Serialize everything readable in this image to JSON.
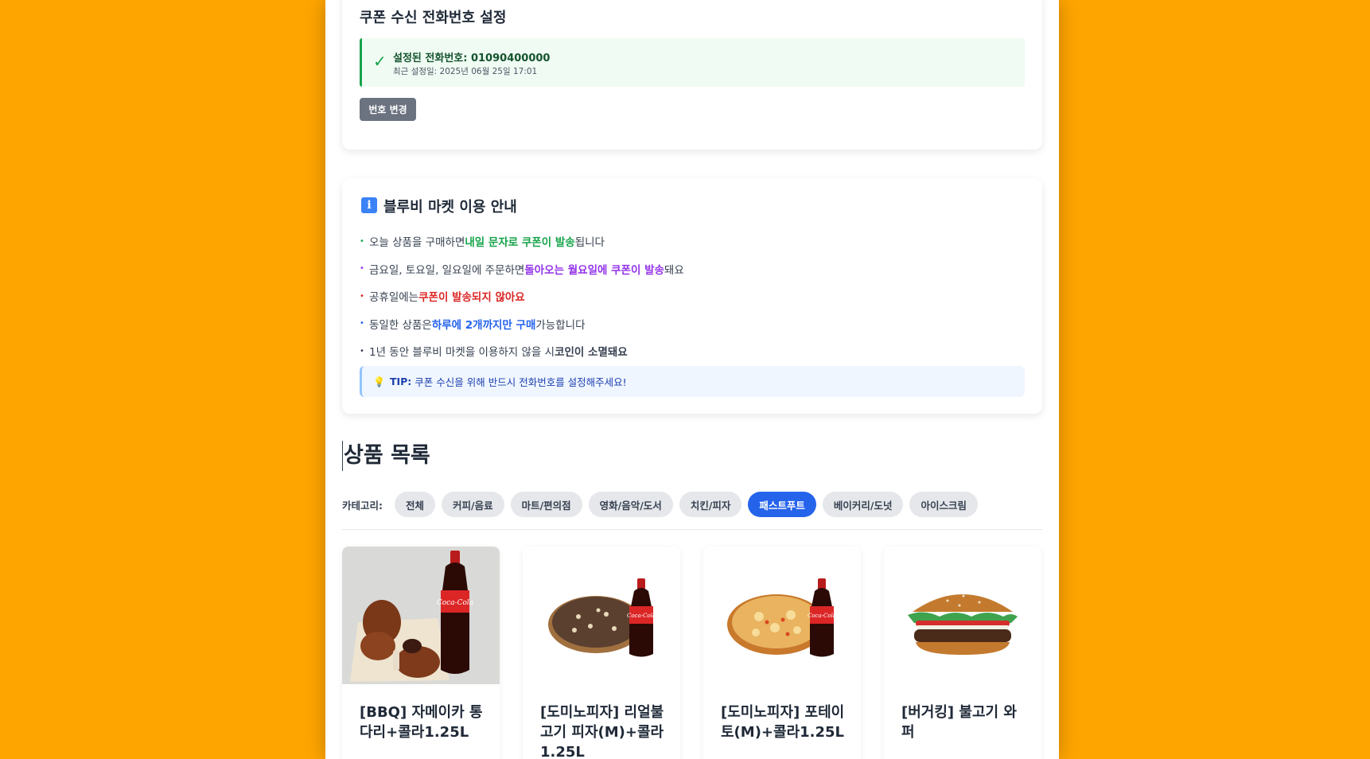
{
  "colors": {
    "background": "#FFA500",
    "accent": "#2563eb",
    "success": "#16a34a",
    "purple": "#9333ea",
    "danger": "#dc2626"
  },
  "phone_settings": {
    "title": "쿠폰 수신 전화번호 설정",
    "check_icon": "✓",
    "phone_line": "설정된 전화번호: 01090400000",
    "updated": "최근 설정일: 2025년 06월 25일 17:01",
    "change_button": "번호 변경"
  },
  "guide": {
    "icon": "info-icon",
    "title": "블루비 마켓 이용 안내",
    "items": [
      {
        "pre": "오늘 상품을 구매하면 ",
        "hl": "내일 문자로 쿠폰이 발송",
        "post": "됩니다",
        "color": "#16a34a"
      },
      {
        "pre": "금요일, 토요일, 일요일에 주문하면 ",
        "hl": "돌아오는 월요일에 쿠폰이 발송",
        "post": "돼요",
        "color": "#9333ea"
      },
      {
        "pre": "공휴일에는 ",
        "hl": "쿠폰이 발송되지 않아요",
        "post": "",
        "color": "#dc2626"
      },
      {
        "pre": "동일한 상품은 ",
        "hl": "하루에 2개까지만 구매",
        "post": " 가능합니다",
        "color": "#2563eb"
      },
      {
        "pre": "1년 동안 블루비 마켓을 이용하지 않을 시 ",
        "hl": "코인이 소멸돼요",
        "post": "",
        "color": "#374151"
      }
    ],
    "tip_label": "TIP:",
    "tip_text": "쿠폰 수신을 위해 반드시 전화번호를 설정해주세요!"
  },
  "products_section": {
    "title": "상품 목록",
    "category_label": "카테고리:",
    "categories": [
      "전체",
      "커피/음료",
      "마트/편의점",
      "영화/음악/도서",
      "치킨/피자",
      "패스트푸트",
      "베이커리/도넛",
      "아이스크림"
    ],
    "active_category": "패스트푸트",
    "products": [
      {
        "name": "[BBQ] 자메이카 통다리+콜라1.25L",
        "image": "chicken-cola"
      },
      {
        "name": "[도미노피자] 리얼불고기 피자(M)+콜라1.25L",
        "image": "pizza-bulgogi-cola"
      },
      {
        "name": "[도미노피자] 포테이토(M)+콜라1.25L",
        "image": "pizza-potato-cola"
      },
      {
        "name": "[버거킹] 불고기 와퍼",
        "image": "burger"
      }
    ]
  }
}
